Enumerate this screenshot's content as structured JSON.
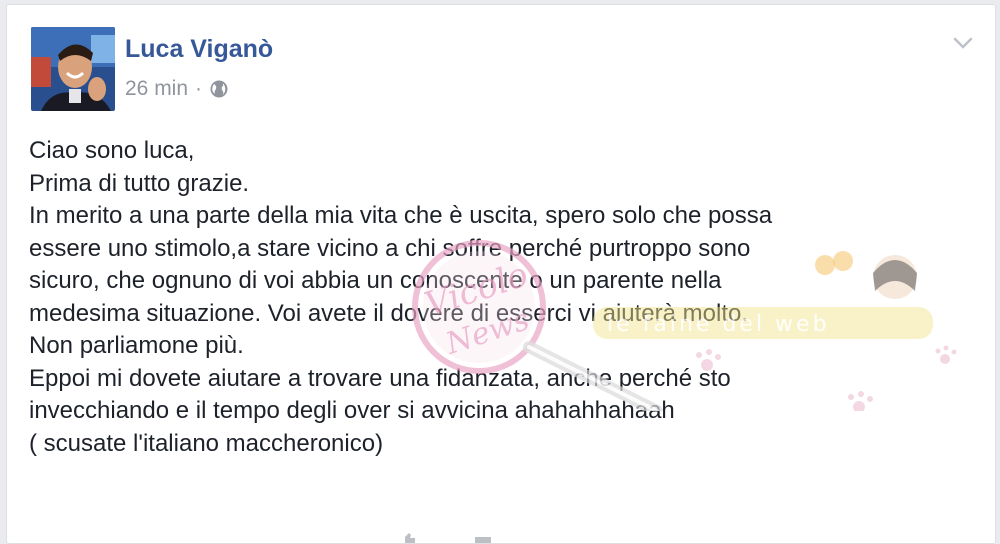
{
  "post": {
    "author": "Luca Viganò",
    "time": "26 min",
    "separator": "·",
    "privacy_icon": "globe-icon",
    "menu_icon": "chevron-down-icon",
    "lines": [
      "Ciao sono luca,",
      "Prima di tutto grazie.",
      "In merito a una parte della mia vita che è uscita, spero solo che possa",
      "essere uno stimolo,a stare vicino a chi soffre perché purtroppo sono",
      "sicuro, che ognuno di voi abbia un conoscente o un parente nella",
      "medesima situazione. Voi avete il dovere di esserci vi aiuterà molto.",
      "Non parliamone più.",
      "Eppoi mi dovete aiutare a trovare una fidanzata, anche perché sto",
      "invecchiando e il tempo degli over si avvicina ahahahhahaah",
      "( scusate l'italiano maccheronico)"
    ]
  },
  "watermark": {
    "script_text": "Vicolo delle News",
    "banner_text": "le faine del web"
  },
  "colors": {
    "author_link": "#365899",
    "meta_gray": "#90949c",
    "body_text": "#1d2129",
    "watermark_pink": "#e8a3c4",
    "watermark_yellow": "#f3e48a"
  }
}
